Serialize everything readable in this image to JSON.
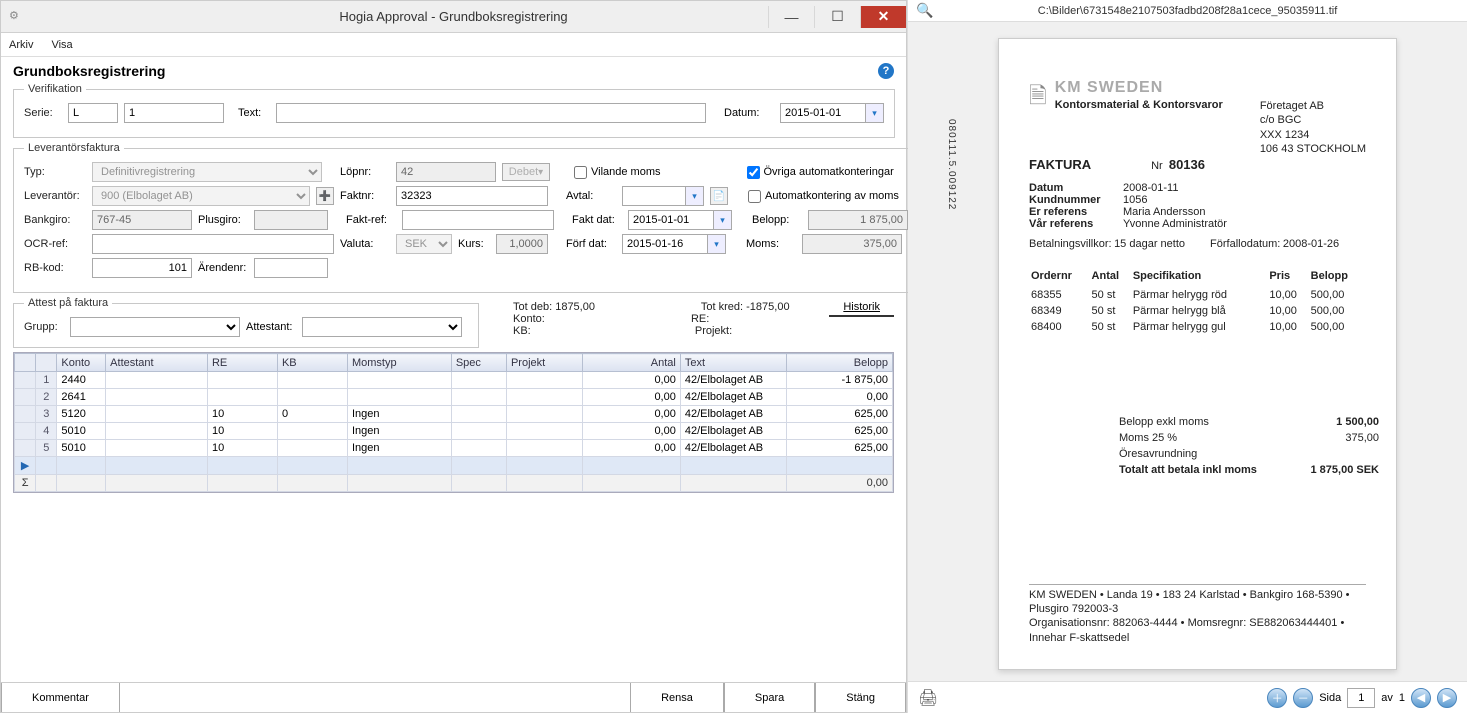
{
  "window": {
    "title": "Hogia Approval - Grundboksregistrering"
  },
  "menu": {
    "arkiv": "Arkiv",
    "visa": "Visa"
  },
  "header": {
    "title": "Grundboksregistrering"
  },
  "verifikation": {
    "legend": "Verifikation",
    "serie_label": "Serie:",
    "serie": "L",
    "nr": "1",
    "text_label": "Text:",
    "text": "",
    "datum_label": "Datum:",
    "datum": "2015-01-01"
  },
  "lev": {
    "legend": "Leverantörsfaktura",
    "typ_label": "Typ:",
    "typ": "Definitivregistrering",
    "lopnr_label": "Löpnr:",
    "lopnr": "42",
    "debet": "Debet",
    "vilande": "Vilande moms",
    "ovriga": "Övriga automatkonteringar",
    "automoms": "Automatkontering av moms",
    "leverantor_label": "Leverantör:",
    "leverantor": "900 (Elbolaget AB)",
    "faktnr_label": "Faktnr:",
    "faktnr": "32323",
    "avtal_label": "Avtal:",
    "avtal": "",
    "bankgiro_label": "Bankgiro:",
    "bankgiro": "767-45",
    "plusgiro_label": "Plusgiro:",
    "plusgiro": "",
    "faktref_label": "Fakt-ref:",
    "faktref": "",
    "faktdat_label": "Fakt dat:",
    "faktdat": "2015-01-01",
    "belopp_label": "Belopp:",
    "belopp": "1 875,00",
    "ocr_label": "OCR-ref:",
    "ocr": "",
    "valuta_label": "Valuta:",
    "valuta": "SEK",
    "kurs_label": "Kurs:",
    "kurs": "1,0000",
    "forf_label": "Förf dat:",
    "forf": "2015-01-16",
    "moms_label": "Moms:",
    "moms": "375,00",
    "rbkod_label": "RB-kod:",
    "rbkod": "101",
    "arendenr_label": "Ärendenr:",
    "arendenr": ""
  },
  "attest": {
    "legend": "Attest på faktura",
    "grupp_label": "Grupp:",
    "attestant_label": "Attestant:",
    "totdeb_label": "Tot deb:",
    "totdeb": "1875,00",
    "totkred_label": "Tot kred:",
    "totkred": "-1875,00",
    "konto_label": "Konto:",
    "re_label": "RE:",
    "kb_label": "KB:",
    "projekt_label": "Projekt:",
    "historik": "Historik"
  },
  "grid": {
    "cols": {
      "konto": "Konto",
      "attestant": "Attestant",
      "re": "RE",
      "kb": "KB",
      "momstyp": "Momstyp",
      "spec": "Spec",
      "projekt": "Projekt",
      "antal": "Antal",
      "text": "Text",
      "belopp": "Belopp"
    },
    "rows": [
      {
        "n": "1",
        "konto": "2440",
        "attestant": "",
        "re": "",
        "kb": "",
        "momstyp": "",
        "antal": "0,00",
        "text": "42/Elbolaget AB",
        "belopp": "-1 875,00"
      },
      {
        "n": "2",
        "konto": "2641",
        "attestant": "",
        "re": "",
        "kb": "",
        "momstyp": "",
        "antal": "0,00",
        "text": "42/Elbolaget AB",
        "belopp": "0,00"
      },
      {
        "n": "3",
        "konto": "5120",
        "attestant": "",
        "re": "10",
        "kb": "0",
        "momstyp": "Ingen",
        "antal": "0,00",
        "text": "42/Elbolaget AB",
        "belopp": "625,00"
      },
      {
        "n": "4",
        "konto": "5010",
        "attestant": "",
        "re": "10",
        "kb": "",
        "momstyp": "Ingen",
        "antal": "0,00",
        "text": "42/Elbolaget AB",
        "belopp": "625,00"
      },
      {
        "n": "5",
        "konto": "5010",
        "attestant": "",
        "re": "10",
        "kb": "",
        "momstyp": "Ingen",
        "antal": "0,00",
        "text": "42/Elbolaget AB",
        "belopp": "625,00"
      }
    ],
    "sum": "0,00"
  },
  "buttons": {
    "kommentar": "Kommentar",
    "rensa": "Rensa",
    "spara": "Spara",
    "stang": "Stäng"
  },
  "viewer": {
    "path": "C:\\Bilder\\6731548e2107503fadbd208f28a1cece_95035911.tif",
    "sida_label": "Sida",
    "sida": "1",
    "av_label": "av",
    "total": "1"
  },
  "invoice": {
    "sidecode": "080111.5.009122",
    "logo": "KM SWEDEN",
    "logosub": "Kontorsmaterial & Kontorsvaror",
    "addr": [
      "Företaget AB",
      "c/o BGC",
      "XXX 1234",
      "106 43  STOCKHOLM"
    ],
    "title": "FAKTURA",
    "nr_label": "Nr",
    "nr": "80136",
    "datum_label": "Datum",
    "datum": "2008-01-11",
    "kund_label": "Kundnummer",
    "kund": "1056",
    "eref_label": "Er referens",
    "eref": "Maria Andersson",
    "vref_label": "Vår referens",
    "vref": "Yvonne Administratör",
    "terms_label": "Betalningsvillkor:",
    "terms": "15 dagar netto",
    "due_label": "Förfallodatum:",
    "due": "2008-01-26",
    "th": {
      "order": "Ordernr",
      "antal": "Antal",
      "spec": "Specifikation",
      "pris": "Pris",
      "belopp": "Belopp"
    },
    "lines": [
      {
        "order": "68355",
        "antal": "50 st",
        "spec": "Pärmar helrygg röd",
        "pris": "10,00",
        "belopp": "500,00"
      },
      {
        "order": "68349",
        "antal": "50 st",
        "spec": "Pärmar helrygg blå",
        "pris": "10,00",
        "belopp": "500,00"
      },
      {
        "order": "68400",
        "antal": "50 st",
        "spec": "Pärmar helrygg gul",
        "pris": "10,00",
        "belopp": "500,00"
      }
    ],
    "excl_label": "Belopp exkl moms",
    "excl": "1 500,00",
    "m25_label": "Moms 25 %",
    "m25": "375,00",
    "round_label": "Öresavrundning",
    "round": "",
    "total_label": "Totalt att betala inkl moms",
    "total": "1 875,00 SEK",
    "footer1": "KM SWEDEN • Landa 19 • 183 24 Karlstad • Bankgiro 168-5390 • Plusgiro 792003-3",
    "footer2": "Organisationsnr: 882063-4444 • Momsregnr: SE882063444401 • Innehar F-skattsedel"
  }
}
